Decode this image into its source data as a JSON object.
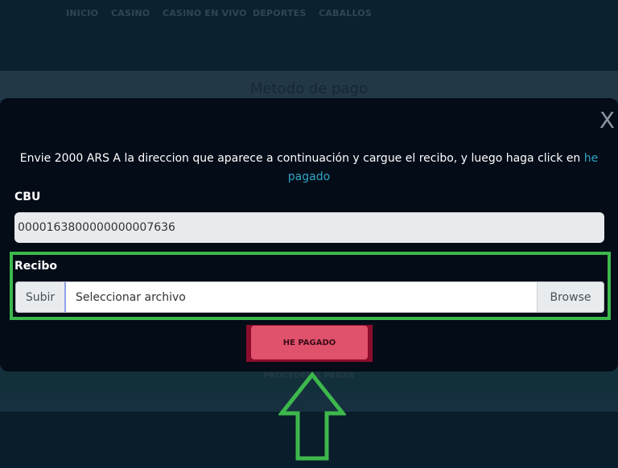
{
  "nav": {
    "items": [
      "INICIO",
      "CASINO",
      "CASINO EN VIVO",
      "DEPORTES",
      "CABALLOS"
    ]
  },
  "background": {
    "title": "Metodo de pago",
    "proceed_label": "PROCEDER A PAGAR"
  },
  "modal": {
    "close_label": "X",
    "instruction_main": "Envie 2000 ARS A la direccion que aparece a continuación y cargue el recibo, y luego haga click en ",
    "instruction_link": "he pagado",
    "cbu_label": "CBU",
    "cbu_value": "0000163800000000007636",
    "recibo_label": "Recibo",
    "file_prefix": "Subir",
    "file_placeholder": "Seleccionar archivo",
    "browse_label": "Browse",
    "pay_button_label": "HE PAGADO"
  },
  "colors": {
    "highlight_outline": "#3db84c",
    "pay_button": "#e0516c",
    "link": "#2fa5c4"
  },
  "icons": {
    "annotation": "arrow-up-icon"
  }
}
